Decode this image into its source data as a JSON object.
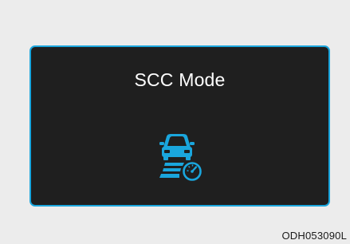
{
  "display": {
    "title": "SCC Mode",
    "icon": "scc-car-speedometer-icon",
    "accent_color": "#1aa6dd"
  },
  "figure_code": "ODH053090L"
}
